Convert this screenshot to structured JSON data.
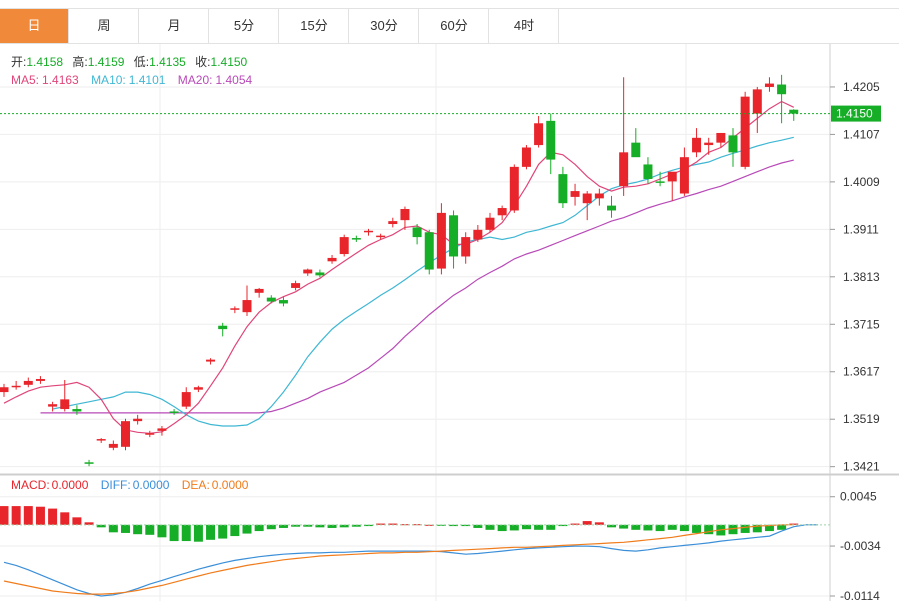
{
  "tabs": [
    "日",
    "周",
    "月",
    "5分",
    "15分",
    "30分",
    "60分",
    "4时"
  ],
  "active_tab": 0,
  "ohlc_legend": {
    "open_label": "开:",
    "open": "1.4158",
    "high_label": "高:",
    "high": "1.4159",
    "low_label": "低:",
    "low": "1.4135",
    "close_label": "收:",
    "close": "1.4150"
  },
  "ma_legend": {
    "ma5_label": "MA5:",
    "ma5": "1.4163",
    "ma10_label": "MA10:",
    "ma10": "1.4101",
    "ma20_label": "MA20:",
    "ma20": "1.4054"
  },
  "macd_legend": {
    "macd_label": "MACD:",
    "macd": "0.0000",
    "diff_label": "DIFF:",
    "diff": "0.0000",
    "dea_label": "DEA:",
    "dea": "0.0000"
  },
  "current_price_label": "1.4150",
  "colors": {
    "up": "#e8252b",
    "down": "#16ad27",
    "ma5": "#e0457a",
    "ma10": "#3fb7d3",
    "ma20": "#b84ab8",
    "diff": "#3b8fd8",
    "dea": "#f07c1c",
    "price_tag": "#16ad27"
  },
  "chart_data": [
    {
      "type": "candlestick",
      "y_ticks": [
        "1.4205",
        "1.4107",
        "1.4009",
        "1.3911",
        "1.3813",
        "1.3715",
        "1.3617",
        "1.3519",
        "1.3421"
      ],
      "ylim": [
        1.341,
        1.424
      ],
      "candles": [
        [
          1.3575,
          1.3592,
          1.3565,
          1.3585
        ],
        [
          1.3585,
          1.3598,
          1.358,
          1.3588
        ],
        [
          1.359,
          1.3605,
          1.3585,
          1.3598
        ],
        [
          1.3598,
          1.3608,
          1.3592,
          1.3602
        ],
        [
          1.3545,
          1.3555,
          1.3535,
          1.355
        ],
        [
          1.354,
          1.36,
          1.3535,
          1.356
        ],
        [
          1.354,
          1.3548,
          1.3528,
          1.3535
        ],
        [
          1.343,
          1.3435,
          1.3422,
          1.3428
        ],
        [
          1.3475,
          1.348,
          1.347,
          1.3478
        ],
        [
          1.346,
          1.3475,
          1.3455,
          1.3468
        ],
        [
          1.3462,
          1.352,
          1.3455,
          1.3515
        ],
        [
          1.3515,
          1.3528,
          1.3508,
          1.352
        ],
        [
          1.3488,
          1.3495,
          1.3482,
          1.349
        ],
        [
          1.3495,
          1.3505,
          1.3485,
          1.35
        ],
        [
          1.3535,
          1.354,
          1.3528,
          1.3532
        ],
        [
          1.3545,
          1.3585,
          1.354,
          1.3575
        ],
        [
          1.358,
          1.3588,
          1.3575,
          1.3585
        ],
        [
          1.3638,
          1.3645,
          1.3632,
          1.3642
        ],
        [
          1.3712,
          1.3718,
          1.369,
          1.3705
        ],
        [
          1.3745,
          1.3752,
          1.3738,
          1.3748
        ],
        [
          1.374,
          1.3795,
          1.3732,
          1.3765
        ],
        [
          1.378,
          1.379,
          1.377,
          1.3788
        ],
        [
          1.377,
          1.3775,
          1.3758,
          1.3762
        ],
        [
          1.3765,
          1.3772,
          1.3752,
          1.3758
        ],
        [
          1.379,
          1.3805,
          1.3785,
          1.38
        ],
        [
          1.382,
          1.383,
          1.3815,
          1.3828
        ],
        [
          1.3822,
          1.3828,
          1.3812,
          1.3816
        ],
        [
          1.3845,
          1.3858,
          1.384,
          1.3852
        ],
        [
          1.386,
          1.39,
          1.3855,
          1.3895
        ],
        [
          1.3893,
          1.3898,
          1.3885,
          1.389
        ],
        [
          1.3905,
          1.3912,
          1.3898,
          1.3908
        ],
        [
          1.3895,
          1.3902,
          1.389,
          1.3898
        ],
        [
          1.3922,
          1.3935,
          1.3915,
          1.3928
        ],
        [
          1.393,
          1.3958,
          1.391,
          1.3953
        ],
        [
          1.3915,
          1.3922,
          1.388,
          1.3895
        ],
        [
          1.3905,
          1.391,
          1.3818,
          1.3828
        ],
        [
          1.383,
          1.3965,
          1.3818,
          1.3945
        ],
        [
          1.394,
          1.395,
          1.383,
          1.3855
        ],
        [
          1.3855,
          1.3905,
          1.384,
          1.3895
        ],
        [
          1.389,
          1.392,
          1.3885,
          1.391
        ],
        [
          1.391,
          1.3945,
          1.3905,
          1.3935
        ],
        [
          1.394,
          1.396,
          1.393,
          1.3955
        ],
        [
          1.395,
          1.4045,
          1.3945,
          1.404
        ],
        [
          1.404,
          1.4085,
          1.4035,
          1.408
        ],
        [
          1.4085,
          1.4145,
          1.408,
          1.413
        ],
        [
          1.4135,
          1.415,
          1.4025,
          1.4055
        ],
        [
          1.4025,
          1.404,
          1.3955,
          1.3965
        ],
        [
          1.3978,
          1.4005,
          1.396,
          1.399
        ],
        [
          1.3965,
          1.399,
          1.393,
          1.3985
        ],
        [
          1.3975,
          1.3995,
          1.396,
          1.3985
        ],
        [
          1.396,
          1.398,
          1.3935,
          1.395
        ],
        [
          1.4,
          1.4225,
          1.398,
          1.407
        ],
        [
          1.409,
          1.412,
          1.407,
          1.406
        ],
        [
          1.4045,
          1.406,
          1.4005,
          1.4015
        ],
        [
          1.401,
          1.403,
          1.4,
          1.4008
        ],
        [
          1.401,
          1.402,
          1.397,
          1.403
        ],
        [
          1.3985,
          1.408,
          1.398,
          1.406
        ],
        [
          1.407,
          1.412,
          1.406,
          1.41
        ],
        [
          1.4085,
          1.41,
          1.4065,
          1.409
        ],
        [
          1.409,
          1.411,
          1.408,
          1.411
        ],
        [
          1.4105,
          1.412,
          1.404,
          1.407
        ],
        [
          1.404,
          1.4195,
          1.4035,
          1.4185
        ],
        [
          1.415,
          1.4205,
          1.411,
          1.42
        ],
        [
          1.4205,
          1.4225,
          1.4195,
          1.4212
        ],
        [
          1.421,
          1.423,
          1.413,
          1.419
        ],
        [
          1.4158,
          1.4159,
          1.4135,
          1.415
        ]
      ],
      "ma5": [
        1.3552,
        1.3565,
        1.3577,
        1.3585,
        1.3588,
        1.359,
        1.3595,
        1.3585,
        1.356,
        1.352,
        1.3497,
        1.3492,
        1.349,
        1.3493,
        1.351,
        1.3528,
        1.3552,
        1.3588,
        1.3625,
        1.367,
        1.371,
        1.374,
        1.376,
        1.3772,
        1.3782,
        1.3798,
        1.381,
        1.3828,
        1.3845,
        1.3862,
        1.3878,
        1.389,
        1.39,
        1.3915,
        1.3918,
        1.3905,
        1.39,
        1.388,
        1.388,
        1.389,
        1.3905,
        1.3925,
        1.396,
        1.4,
        1.4045,
        1.407,
        1.4065,
        1.4045,
        1.402,
        1.4,
        1.399,
        1.3998,
        1.4,
        1.4005,
        1.4015,
        1.4025,
        1.4035,
        1.405,
        1.407,
        1.408,
        1.41,
        1.412,
        1.414,
        1.416,
        1.4175,
        1.4163
      ],
      "ma10": [
        1.354,
        1.3545,
        1.355,
        1.3555,
        1.356,
        1.3565,
        1.3575,
        1.3575,
        1.357,
        1.356,
        1.3545,
        1.3528,
        1.3515,
        1.3508,
        1.3505,
        1.3505,
        1.3507,
        1.352,
        1.3545,
        1.3575,
        1.361,
        1.3648,
        1.3678,
        1.3705,
        1.3725,
        1.3742,
        1.3758,
        1.3775,
        1.379,
        1.3807,
        1.3825,
        1.3842,
        1.3858,
        1.3872,
        1.3885,
        1.389,
        1.3895,
        1.389,
        1.3895,
        1.3905,
        1.391,
        1.3918,
        1.3925,
        1.394,
        1.396,
        1.398,
        1.3995,
        1.4003,
        1.4008,
        1.4015,
        1.4025,
        1.4033,
        1.404,
        1.4045,
        1.405,
        1.406,
        1.4068,
        1.4075,
        1.4083,
        1.409,
        1.4095,
        1.4101
      ],
      "ma20": [
        1.3532,
        1.3532,
        1.3532,
        1.3532,
        1.3532,
        1.3532,
        1.3532,
        1.3532,
        1.3532,
        1.3532,
        1.3532,
        1.3532,
        1.3532,
        1.3532,
        1.3532,
        1.3532,
        1.3532,
        1.3532,
        1.3532,
        1.3535,
        1.3542,
        1.3552,
        1.3562,
        1.3575,
        1.3585,
        1.3595,
        1.361,
        1.3625,
        1.3645,
        1.3665,
        1.369,
        1.3712,
        1.3735,
        1.3755,
        1.3775,
        1.379,
        1.3808,
        1.3822,
        1.3835,
        1.385,
        1.386,
        1.3868,
        1.3878,
        1.3888,
        1.3898,
        1.3908,
        1.3918,
        1.3928,
        1.3935,
        1.3945,
        1.3955,
        1.3963,
        1.397,
        1.3978,
        1.3985,
        1.3993,
        1.4,
        1.401,
        1.402,
        1.403,
        1.404,
        1.4048,
        1.4054
      ]
    },
    {
      "type": "bar+line",
      "title": "MACD",
      "y_ticks": [
        "0.0045",
        "-0.0034",
        "-0.0114"
      ],
      "ylim": [
        -0.0122,
        0.0075
      ],
      "macd": [
        0.003,
        0.003,
        0.003,
        0.0029,
        0.0026,
        0.002,
        0.0012,
        0.0004,
        -0.0004,
        -0.0012,
        -0.0013,
        -0.0015,
        -0.0016,
        -0.002,
        -0.0026,
        -0.0026,
        -0.0027,
        -0.0024,
        -0.0022,
        -0.0018,
        -0.0014,
        -0.001,
        -0.0007,
        -0.0005,
        -0.0003,
        -0.0003,
        -0.0004,
        -0.0005,
        -0.0004,
        -0.0003,
        -0.0002,
        0.0002,
        0.0002,
        0.0001,
        0.0001,
        0.0,
        -0.0001,
        -0.0002,
        -0.0002,
        -0.0005,
        -0.0008,
        -0.001,
        -0.0009,
        -0.0007,
        -0.0008,
        -0.0008,
        -0.0002,
        0.0002,
        0.0006,
        0.0004,
        -0.0004,
        -0.0006,
        -0.0008,
        -0.0009,
        -0.001,
        -0.0008,
        -0.001,
        -0.0013,
        -0.0015,
        -0.0017,
        -0.0015,
        -0.0013,
        -0.0012,
        -0.001,
        -0.0008,
        0.0002,
        0.0002,
        0.0001,
        0.0001
      ],
      "diff": [
        -0.006,
        -0.0065,
        -0.0072,
        -0.008,
        -0.0088,
        -0.0096,
        -0.0104,
        -0.011,
        -0.0114,
        -0.0112,
        -0.0108,
        -0.0102,
        -0.0095,
        -0.0089,
        -0.0083,
        -0.0077,
        -0.0071,
        -0.0066,
        -0.0061,
        -0.0057,
        -0.0054,
        -0.0051,
        -0.0049,
        -0.0047,
        -0.0046,
        -0.0045,
        -0.0045,
        -0.0044,
        -0.0044,
        -0.0043,
        -0.0042,
        -0.0042,
        -0.0042,
        -0.0042,
        -0.0042,
        -0.0042,
        -0.0043,
        -0.0045,
        -0.0047,
        -0.0046,
        -0.0044,
        -0.0042,
        -0.004,
        -0.0038,
        -0.0037,
        -0.0036,
        -0.0035,
        -0.0034,
        -0.0034,
        -0.0035,
        -0.0038,
        -0.0041,
        -0.0042,
        -0.004,
        -0.0037,
        -0.0035,
        -0.0033,
        -0.0031,
        -0.0029,
        -0.0026,
        -0.0024,
        -0.0022,
        -0.002,
        -0.0018,
        -0.001,
        -0.0003,
        0.0,
        0.0
      ],
      "dea": [
        -0.009,
        -0.0094,
        -0.0098,
        -0.0102,
        -0.0106,
        -0.0108,
        -0.011,
        -0.0111,
        -0.0111,
        -0.011,
        -0.0108,
        -0.0105,
        -0.0101,
        -0.0097,
        -0.0092,
        -0.0087,
        -0.0082,
        -0.0077,
        -0.0073,
        -0.0069,
        -0.0065,
        -0.0062,
        -0.0059,
        -0.0056,
        -0.0054,
        -0.0052,
        -0.005,
        -0.0049,
        -0.0048,
        -0.0047,
        -0.0046,
        -0.0045,
        -0.0045,
        -0.0044,
        -0.0044,
        -0.0043,
        -0.0042,
        -0.0041,
        -0.004,
        -0.0039,
        -0.0038,
        -0.0037,
        -0.0036,
        -0.0036,
        -0.0035,
        -0.0034,
        -0.0033,
        -0.0032,
        -0.0031,
        -0.003,
        -0.0029,
        -0.0028,
        -0.0026,
        -0.0024,
        -0.0022,
        -0.002,
        -0.0017,
        -0.0014,
        -0.0011,
        -0.0008,
        -0.0006,
        -0.0004,
        -0.0002,
        -0.0001,
        0.0,
        0.0
      ]
    }
  ]
}
